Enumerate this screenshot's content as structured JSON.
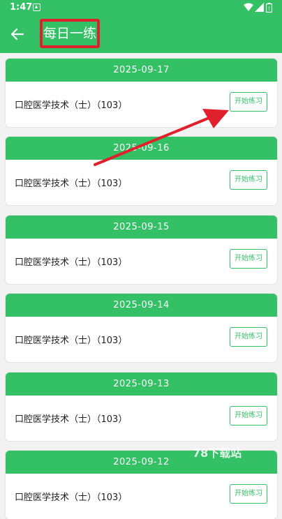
{
  "status_bar": {
    "time": "1:47",
    "icons": [
      "notification-icon",
      "wifi-icon",
      "signal-icon",
      "battery-icon"
    ]
  },
  "app_bar": {
    "title": "每日一练",
    "back_icon": "arrow-left-icon"
  },
  "colors": {
    "primary": "#34c065",
    "highlight": "#e0202a",
    "background": "#f2f2f2"
  },
  "cards": [
    {
      "date": "2025-09-17",
      "course": "口腔医学技术（士）（103）",
      "button": "开始练习"
    },
    {
      "date": "2025-09-16",
      "course": "口腔医学技术（士）（103）",
      "button": "开始练习"
    },
    {
      "date": "2025-09-15",
      "course": "口腔医学技术（士）（103）",
      "button": "开始练习"
    },
    {
      "date": "2025-09-14",
      "course": "口腔医学技术（士）（103）",
      "button": "开始练习"
    },
    {
      "date": "2025-09-13",
      "course": "口腔医学技术（士）（103）",
      "button": "开始练习"
    },
    {
      "date": "2025-09-12",
      "course": "口腔医学技术（士）（103）",
      "button": "开始练习"
    }
  ],
  "watermark": "78下载站"
}
